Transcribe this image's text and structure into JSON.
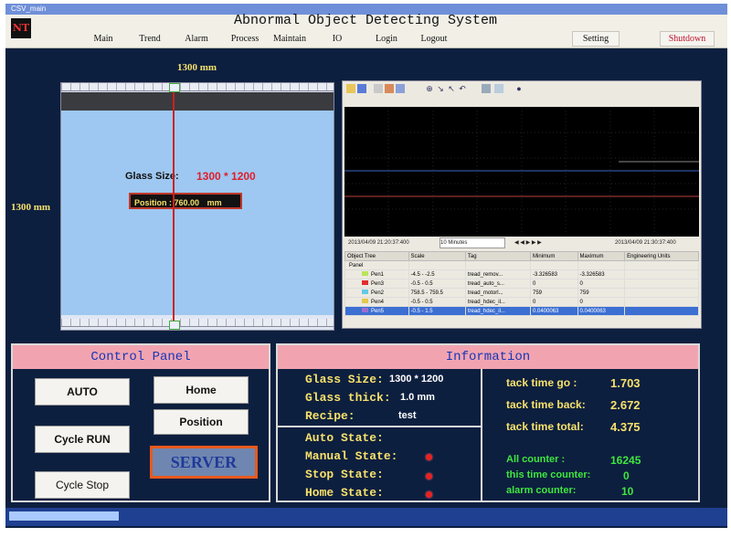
{
  "window": {
    "title": "CSV_main"
  },
  "header": {
    "logo_text": "NT",
    "app_title": "Abnormal Object Detecting System",
    "menu": [
      "Main",
      "Trend",
      "Alarm",
      "Process",
      "Maintain",
      "IO",
      "Login",
      "Logout"
    ],
    "setting_label": "Setting",
    "shutdown_label": "Shutdown"
  },
  "view": {
    "width_label": "1300 mm",
    "height_label": "1300 mm",
    "glass_size_label": "Glass Size:",
    "glass_size_value": "1300 * 1200",
    "position_label": "Position :",
    "position_value": "760.00",
    "position_unit": "mm"
  },
  "trend": {
    "ctrl_left": "2013/04/09 21:20:37:400",
    "ctrl_range": "10 Minutes",
    "ctrl_right": "2013/04/09 21:30:37:400",
    "columns": [
      "Object Tree",
      "Scale",
      "Tag",
      "Minimum",
      "Maximum",
      "Engineering Units"
    ],
    "rows": [
      {
        "name": "Panel",
        "scale": "",
        "tag": "",
        "min": "",
        "max": "",
        "units": "",
        "selected": false
      },
      {
        "name": "Pen1",
        "scale": "-4.5 - -2.5",
        "tag": "tread_remov...",
        "min": "-3.326583",
        "max": "-3.326583",
        "units": "",
        "selected": false
      },
      {
        "name": "Pen3",
        "scale": "-0.5 - 0.5",
        "tag": "tread_auto_s...",
        "min": "0",
        "max": "0",
        "units": "",
        "selected": false
      },
      {
        "name": "Pen2",
        "scale": "758.5 - 759.5",
        "tag": "tread_motorl...",
        "min": "759",
        "max": "759",
        "units": "",
        "selected": false
      },
      {
        "name": "Pen4",
        "scale": "-0.5 - 0.5",
        "tag": "tread_hdec_il...",
        "min": "0",
        "max": "0",
        "units": "",
        "selected": false
      },
      {
        "name": "Pen5",
        "scale": "-0.5 - 1.5",
        "tag": "tread_hdec_il...",
        "min": "0.0400063",
        "max": "0.0400063",
        "units": "",
        "selected": true
      }
    ]
  },
  "control_panel": {
    "title": "Control Panel",
    "buttons": {
      "auto": "AUTO",
      "home": "Home",
      "position": "Position",
      "cycle_run": "Cycle RUN",
      "server": "SERVER",
      "cycle_stop": "Cycle Stop"
    }
  },
  "information": {
    "title": "Information",
    "glass_size_label": "Glass Size:",
    "glass_size_value": "1300 * 1200",
    "glass_thick_label": "Glass thick:",
    "glass_thick_value": "1.0 mm",
    "recipe_label": "Recipe:",
    "recipe_value": "test",
    "auto_state_label": "Auto State:",
    "manual_state_label": "Manual State:",
    "stop_state_label": "Stop State:",
    "home_state_label": "Home State:",
    "tack_go_label": "tack time go :",
    "tack_go_value": "1.703",
    "tack_back_label": "tack time back:",
    "tack_back_value": "2.672",
    "tack_total_label": "tack time total:",
    "tack_total_value": "4.375",
    "all_counter_label": "All counter :",
    "all_counter_value": "16245",
    "this_counter_label": "this time counter:",
    "this_counter_value": "0",
    "alarm_counter_label": "alarm counter:",
    "alarm_counter_value": "10"
  },
  "colors": {
    "workspace_bg": "#0d1f3f",
    "panel_header": "#f1a4b0",
    "label_yellow": "#f7e16b",
    "counter_green": "#3fe63f",
    "alarm_red": "#e62222"
  }
}
